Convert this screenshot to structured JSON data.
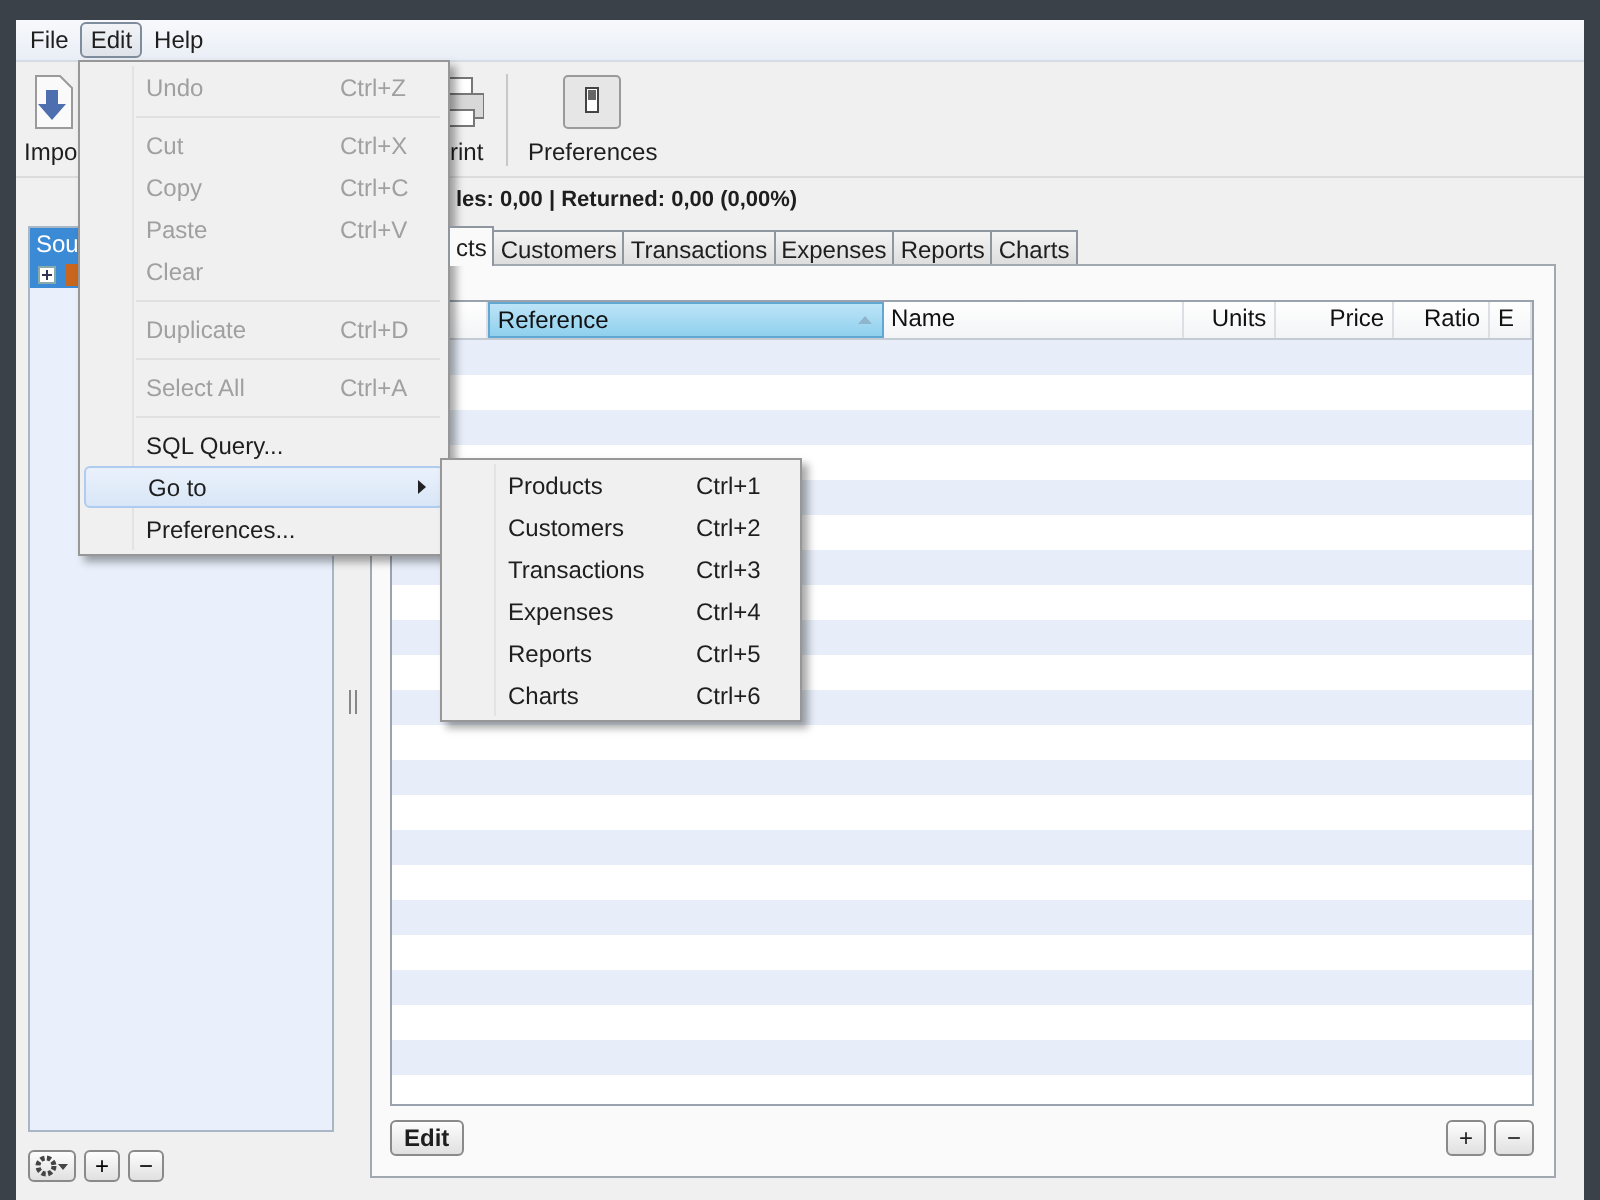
{
  "menubar": [
    {
      "label": "File",
      "selected": false
    },
    {
      "label": "Edit",
      "selected": true
    },
    {
      "label": "Help",
      "selected": false
    }
  ],
  "toolbar": [
    {
      "kind": "import",
      "label": "Impo"
    },
    {
      "kind": "print",
      "label": "rint"
    },
    {
      "kind": "preferences",
      "label": "Preferences"
    }
  ],
  "summary": "les: 0,00 | Returned: 0,00 (0,00%)",
  "sidebar": {
    "header": "Sou",
    "items": [
      {
        "expanded": false,
        "selected": true
      }
    ]
  },
  "tabs": [
    {
      "label": "cts",
      "selected": true
    },
    {
      "label": "Customers",
      "selected": false
    },
    {
      "label": "Transactions",
      "selected": false
    },
    {
      "label": "Expenses",
      "selected": false
    },
    {
      "label": "Reports",
      "selected": false
    },
    {
      "label": "Charts",
      "selected": false
    }
  ],
  "table": {
    "columns": [
      {
        "label": "Reference",
        "selected": true
      },
      {
        "label": "Name",
        "selected": false
      },
      {
        "label": "Units",
        "selected": false
      },
      {
        "label": "Price",
        "selected": false
      },
      {
        "label": "Ratio",
        "selected": false
      },
      {
        "label": "E",
        "selected": false
      }
    ]
  },
  "table_buttons": {
    "edit": "Edit",
    "add": "+",
    "remove": "−"
  },
  "sidebar_buttons": {
    "add": "+",
    "remove": "−"
  },
  "edit_menu": {
    "items": [
      {
        "kind": "item",
        "label": "Undo",
        "shortcut": "Ctrl+Z",
        "disabled": true,
        "selected": false
      },
      {
        "kind": "separator"
      },
      {
        "kind": "item",
        "label": "Cut",
        "shortcut": "Ctrl+X",
        "disabled": true,
        "selected": false
      },
      {
        "kind": "item",
        "label": "Copy",
        "shortcut": "Ctrl+C",
        "disabled": true,
        "selected": false
      },
      {
        "kind": "item",
        "label": "Paste",
        "shortcut": "Ctrl+V",
        "disabled": true,
        "selected": false
      },
      {
        "kind": "item",
        "label": "Clear",
        "disabled": true,
        "selected": false
      },
      {
        "kind": "separator"
      },
      {
        "kind": "item",
        "label": "Duplicate",
        "shortcut": "Ctrl+D",
        "disabled": true,
        "selected": false
      },
      {
        "kind": "separator"
      },
      {
        "kind": "item",
        "label": "Select All",
        "shortcut": "Ctrl+A",
        "disabled": true,
        "selected": false
      },
      {
        "kind": "separator"
      },
      {
        "kind": "item",
        "label": "SQL Query...",
        "disabled": false,
        "selected": false
      },
      {
        "kind": "submenu",
        "label": "Go to",
        "disabled": false,
        "selected": true
      },
      {
        "kind": "item",
        "label": "Preferences...",
        "disabled": false,
        "selected": false
      }
    ]
  },
  "goto_menu": {
    "items": [
      {
        "kind": "item",
        "label": "Products",
        "shortcut": "Ctrl+1",
        "selected": false
      },
      {
        "kind": "item",
        "label": "Customers",
        "shortcut": "Ctrl+2",
        "selected": false
      },
      {
        "kind": "item",
        "label": "Transactions",
        "shortcut": "Ctrl+3",
        "selected": false
      },
      {
        "kind": "item",
        "label": "Expenses",
        "shortcut": "Ctrl+4",
        "selected": false
      },
      {
        "kind": "item",
        "label": "Reports",
        "shortcut": "Ctrl+5",
        "selected": false
      },
      {
        "kind": "item",
        "label": "Charts",
        "shortcut": "Ctrl+6",
        "selected": false
      }
    ]
  }
}
